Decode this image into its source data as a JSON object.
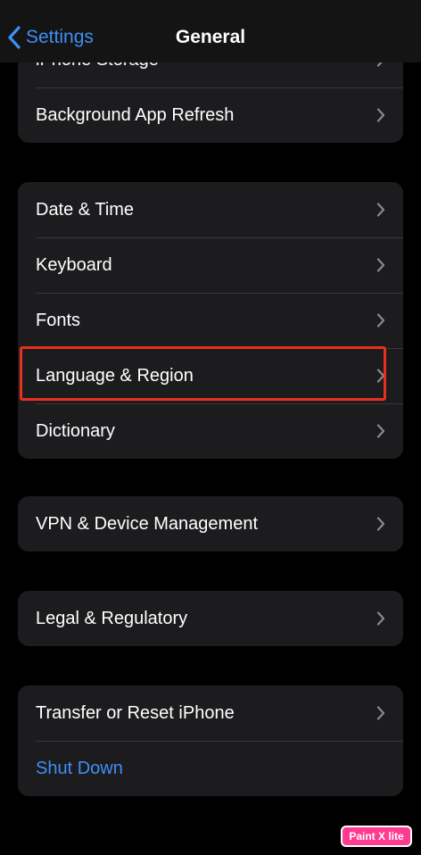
{
  "nav": {
    "back_label": "Settings",
    "title": "General"
  },
  "groups": [
    {
      "items": [
        {
          "label": "iPhone Storage"
        },
        {
          "label": "Background App Refresh"
        }
      ]
    },
    {
      "items": [
        {
          "label": "Date & Time"
        },
        {
          "label": "Keyboard"
        },
        {
          "label": "Fonts"
        },
        {
          "label": "Language & Region",
          "highlighted": true
        },
        {
          "label": "Dictionary"
        }
      ]
    },
    {
      "items": [
        {
          "label": "VPN & Device Management"
        }
      ]
    },
    {
      "items": [
        {
          "label": "Legal & Regulatory"
        }
      ]
    },
    {
      "items": [
        {
          "label": "Transfer or Reset iPhone"
        },
        {
          "label": "Shut Down",
          "style": "link"
        }
      ]
    }
  ],
  "watermark": {
    "text": "Paint X lite"
  },
  "colors": {
    "accent": "#3f8ff5",
    "background": "#000000",
    "cell": "#1c1c1e",
    "highlight": "#e8301f",
    "watermark": "#ff3b8f"
  },
  "icons": [
    "chevron-left-icon",
    "chevron-right-icon"
  ]
}
